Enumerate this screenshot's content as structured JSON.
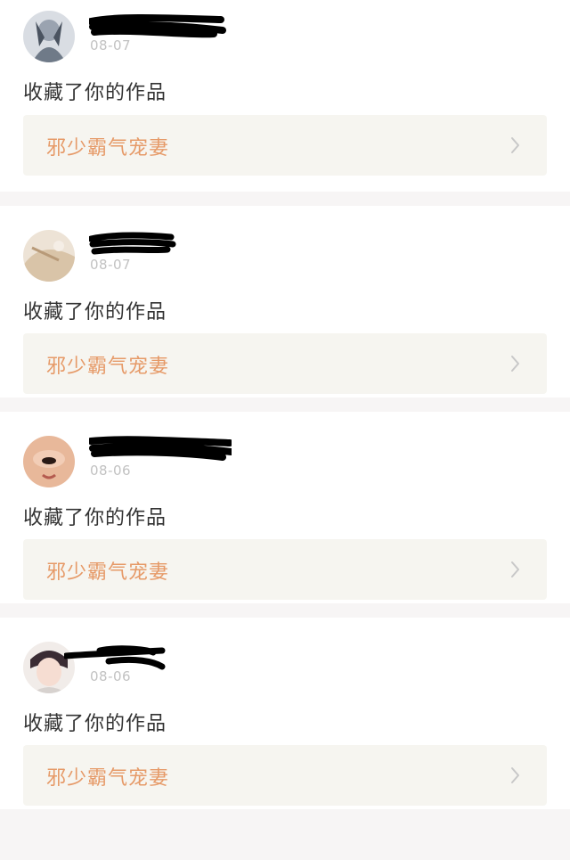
{
  "notifications": [
    {
      "date": "08-07",
      "action": "收藏了你的作品",
      "work_title": "邪少霸气宠妻",
      "avatar_icon": "avatar-anime-icon"
    },
    {
      "date": "08-07",
      "action": "收藏了你的作品",
      "work_title": "邪少霸气宠妻",
      "avatar_icon": "avatar-photo-icon"
    },
    {
      "date": "08-06",
      "action": "收藏了你的作品",
      "work_title": "邪少霸气宠妻",
      "avatar_icon": "avatar-face-icon"
    },
    {
      "date": "08-06",
      "action": "收藏了你的作品",
      "work_title": "邪少霸气宠妻",
      "avatar_icon": "avatar-portrait-icon"
    }
  ],
  "colors": {
    "page_background": "#f7f5f5",
    "card_background": "#ffffff",
    "date_text": "#c2c2c2",
    "action_text": "#333333",
    "work_box_background": "#f6f5f0",
    "work_title_text": "#e69a68",
    "chevron": "#c8c8c8"
  }
}
